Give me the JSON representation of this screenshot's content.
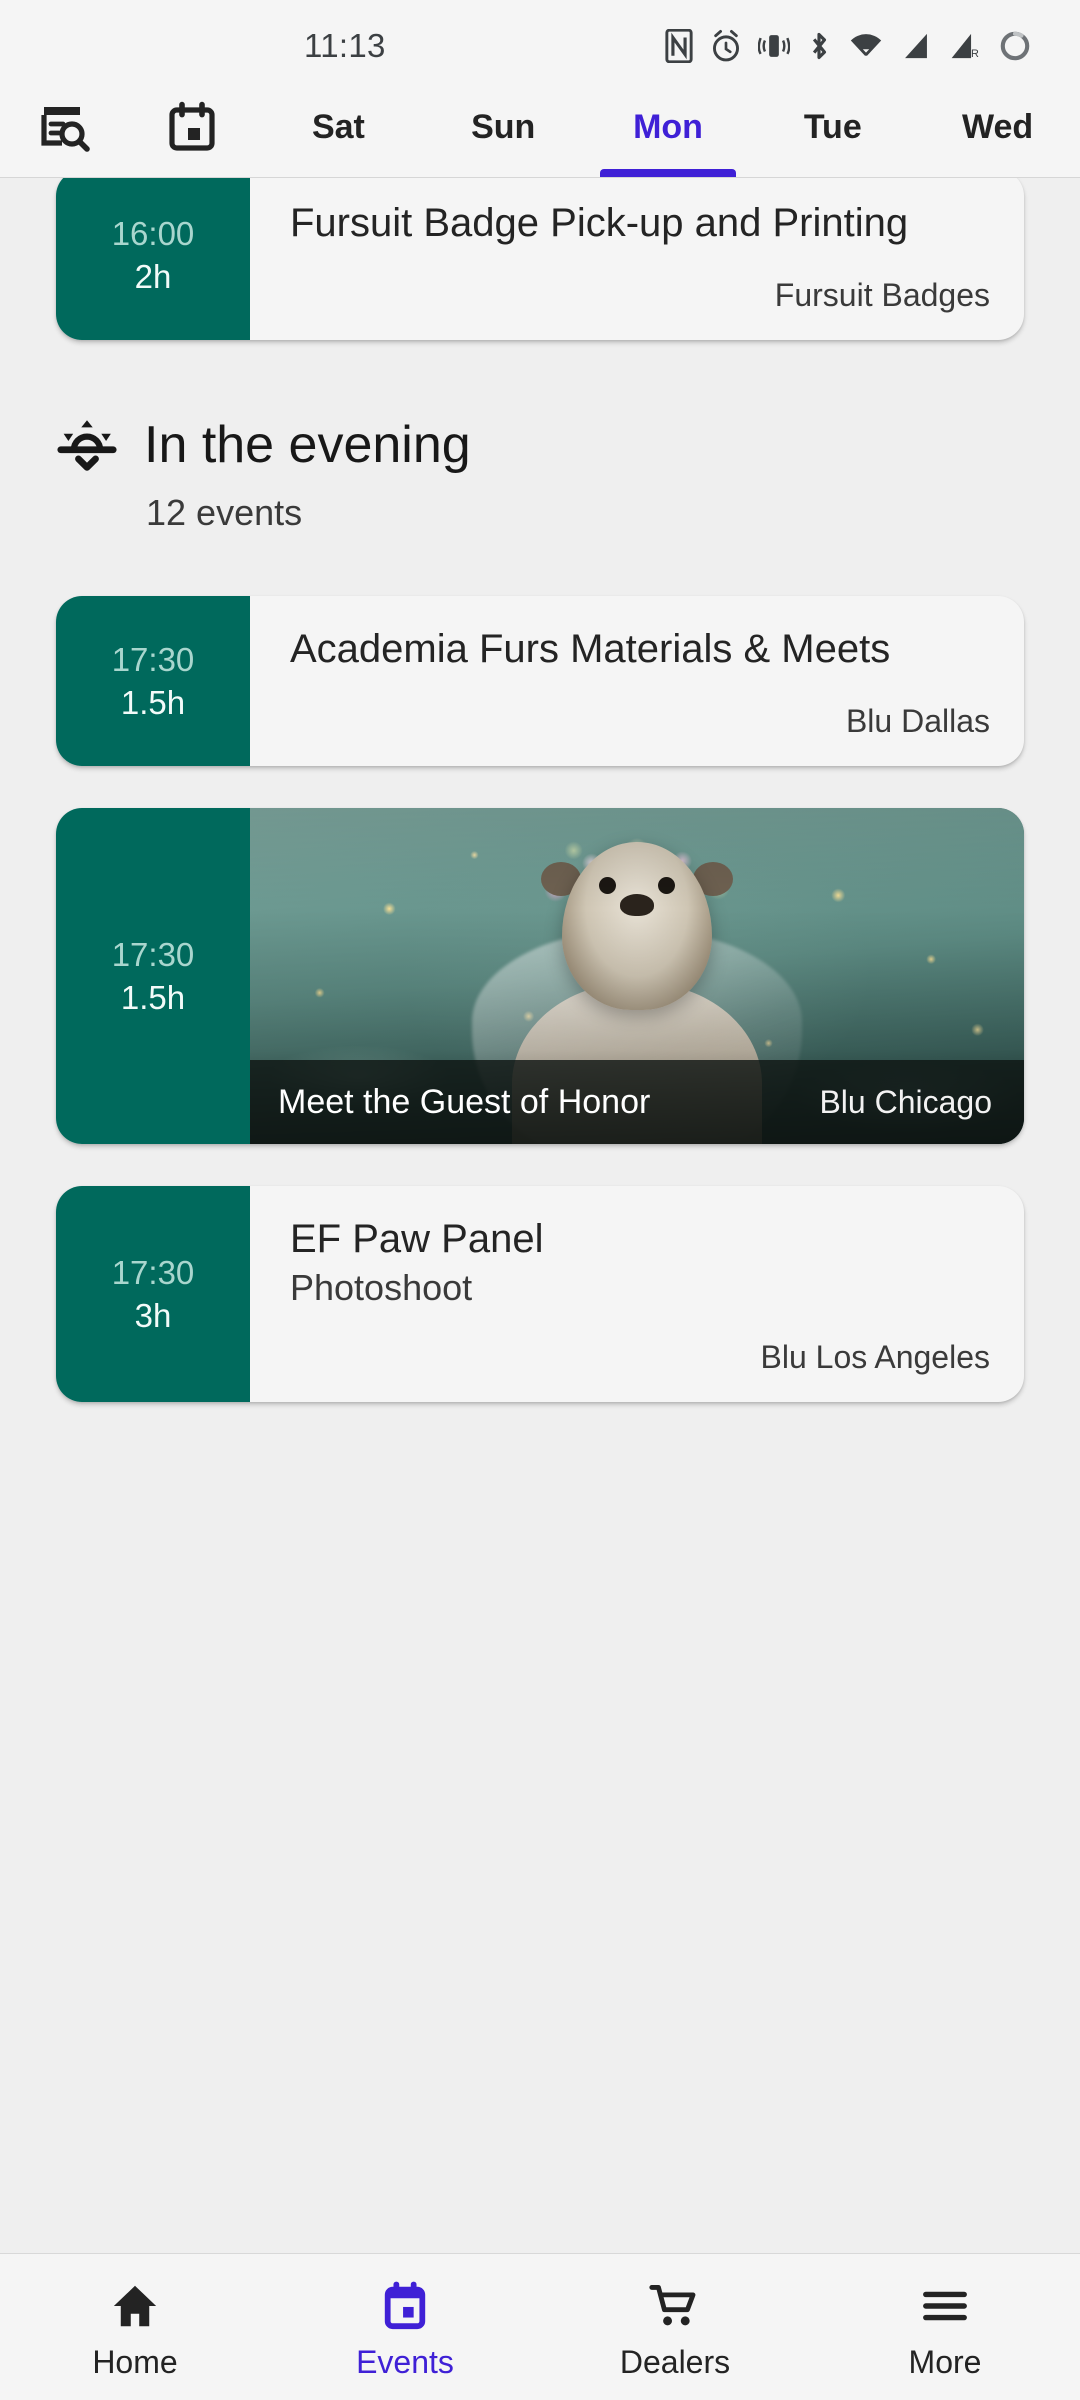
{
  "status_bar": {
    "time": "11:13",
    "icons": [
      "nfc-icon",
      "alarm-icon",
      "vibrate-icon",
      "bluetooth-icon",
      "wifi-icon",
      "signal-icon",
      "signal-roaming-icon",
      "battery-circle-icon"
    ]
  },
  "tab_bar": {
    "search_icon": "search-events-icon",
    "calendar_icon": "calendar-today-icon",
    "tabs": [
      {
        "label": "Sat",
        "active": false
      },
      {
        "label": "Sun",
        "active": false
      },
      {
        "label": "Mon",
        "active": true
      },
      {
        "label": "Tue",
        "active": false
      },
      {
        "label": "Wed",
        "active": false
      }
    ],
    "active_color": "#3F20D6"
  },
  "accent": {
    "time_block": "#00695C",
    "time_text": "#A9D6CE",
    "purple": "#3F20D6"
  },
  "events_top": [
    {
      "start": "16:00",
      "duration": "2h",
      "title": "Fursuit Badge Pick-up and Printing",
      "subtitle": "",
      "location": "Fursuit Badges"
    }
  ],
  "section": {
    "icon": "sunset-icon",
    "title": "In the evening",
    "count": "12 events"
  },
  "events_evening": [
    {
      "start": "17:30",
      "duration": "1.5h",
      "title": "Academia Furs Materials & Meets",
      "subtitle": "",
      "location": "Blu Dallas",
      "has_image": false
    },
    {
      "start": "17:30",
      "duration": "1.5h",
      "title": "Meet the Guest of Honor",
      "subtitle": "",
      "location": "Blu Chicago",
      "has_image": true,
      "image_alt": "otter-in-flower-crown-photo"
    },
    {
      "start": "17:30",
      "duration": "3h",
      "title": "EF Paw Panel",
      "subtitle": "Photoshoot",
      "location": "Blu Los Angeles",
      "has_image": false
    }
  ],
  "bottom_nav": [
    {
      "label": "Home",
      "icon": "home-icon",
      "active": false
    },
    {
      "label": "Events",
      "icon": "calendar-icon",
      "active": true
    },
    {
      "label": "Dealers",
      "icon": "cart-icon",
      "active": false
    },
    {
      "label": "More",
      "icon": "menu-icon",
      "active": false
    }
  ]
}
